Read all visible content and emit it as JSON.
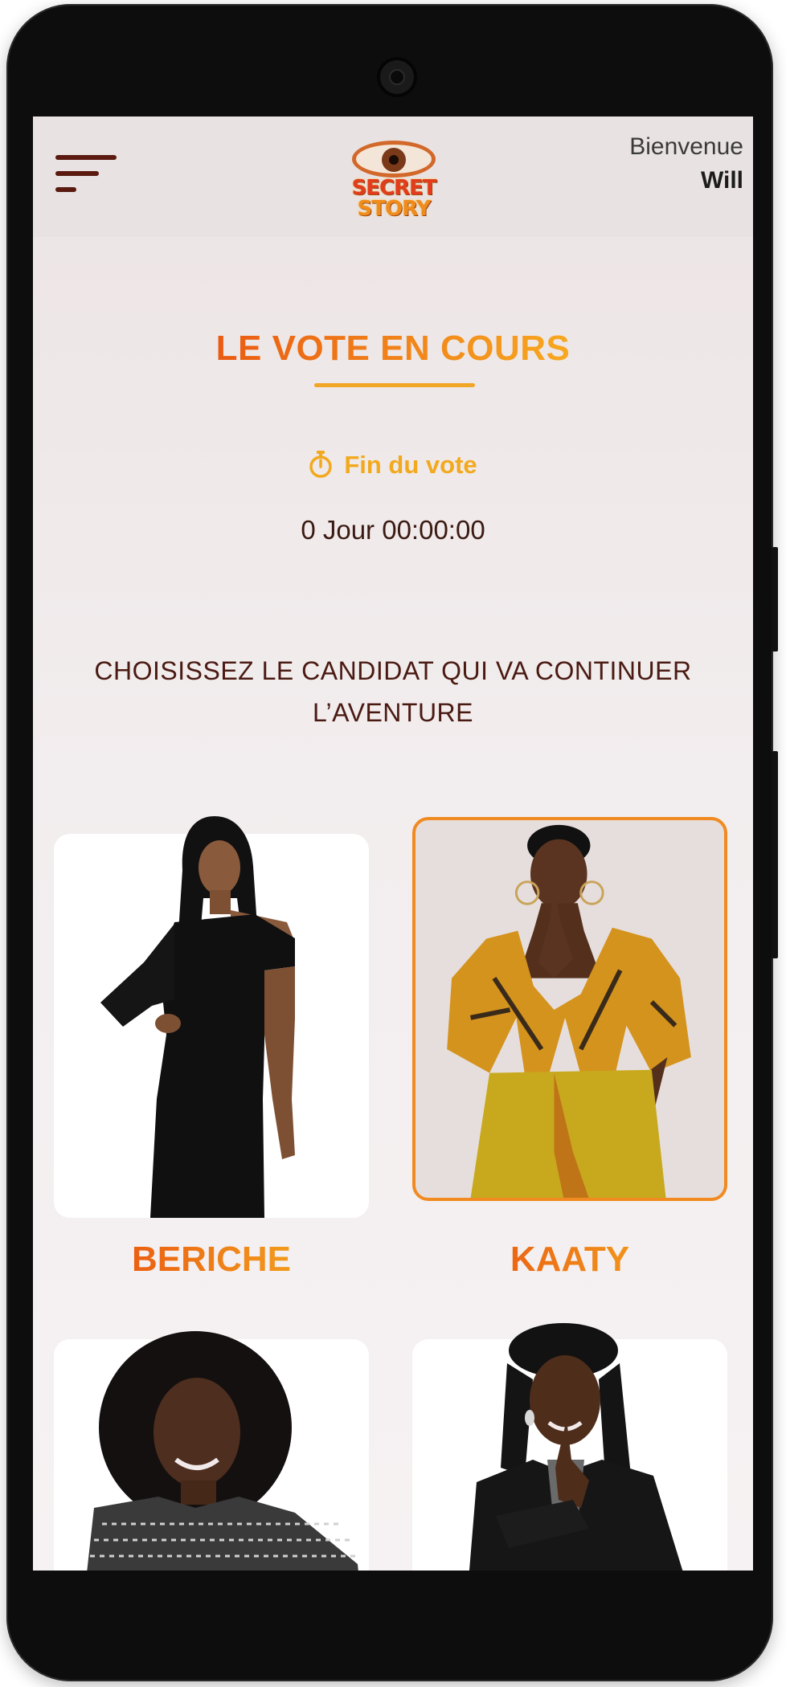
{
  "header": {
    "logo_text_line1": "SECRET",
    "logo_text_line2": "STORY",
    "welcome_label": "Bienvenue",
    "user_name": "Will"
  },
  "vote": {
    "title": "LE VOTE EN COURS",
    "end_label": "Fin du vote",
    "countdown": "0 Jour 00:00:00",
    "instruction_line1": "CHOISISSEZ LE CANDIDAT QUI VA CONTINUER",
    "instruction_line2": "L’AVENTURE"
  },
  "candidates": [
    {
      "name": "BERICHE",
      "selected": false
    },
    {
      "name": "KAATY",
      "selected": true
    },
    {
      "name": "",
      "selected": false
    },
    {
      "name": "",
      "selected": false
    }
  ],
  "colors": {
    "accent_orange": "#ef7c1c",
    "accent_yellow": "#f2a91d",
    "dark_brown": "#4a1a12",
    "selected_border": "#f08a21"
  },
  "icons": {
    "menu": "hamburger-menu-icon",
    "timer": "stopwatch-icon"
  }
}
